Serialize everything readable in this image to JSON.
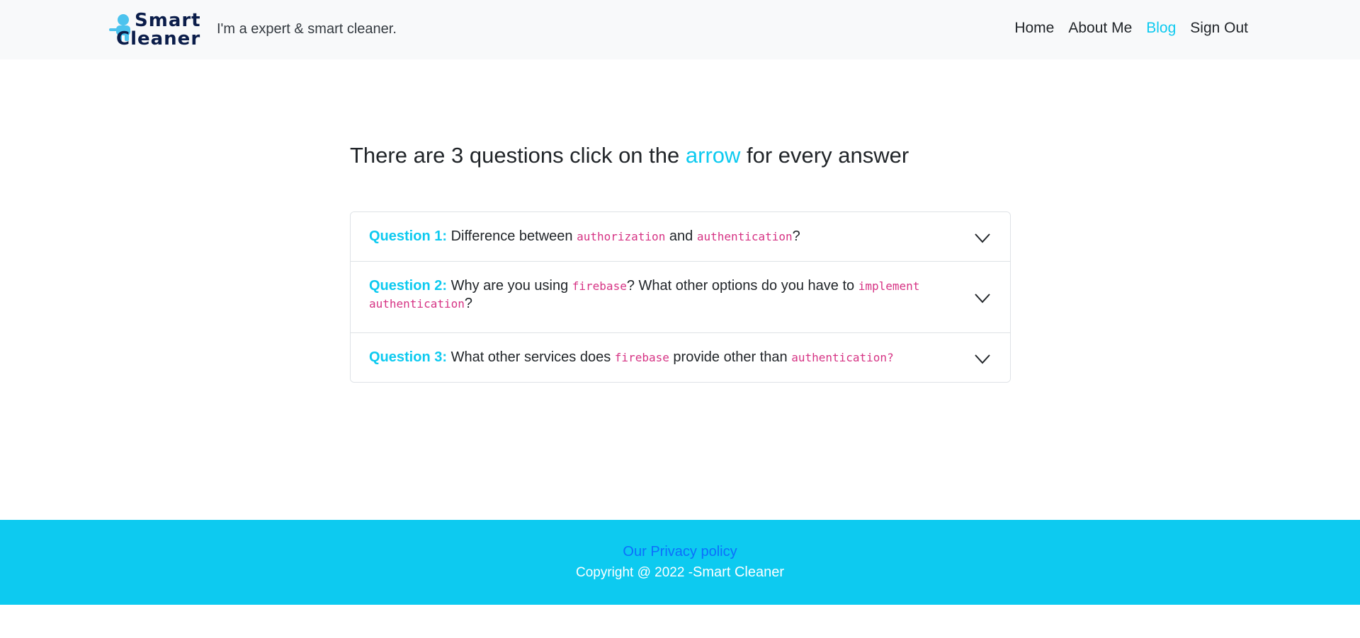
{
  "navbar": {
    "brand_line1": "Smart",
    "brand_line2": "Cleaner",
    "tagline": "I'm a expert & smart cleaner.",
    "links": [
      {
        "label": "Home",
        "active": false
      },
      {
        "label": "About Me",
        "active": false
      },
      {
        "label": "Blog",
        "active": true
      },
      {
        "label": "Sign Out",
        "active": false
      }
    ]
  },
  "main": {
    "heading_before": "There are 3 questions click on the ",
    "heading_accent": "arrow",
    "heading_after": " for every answer",
    "questions": [
      {
        "label": "Question 1:",
        "parts": [
          " Difference between ",
          "authorization",
          " and ",
          "authentication",
          "?"
        ]
      },
      {
        "label": "Question 2:",
        "parts": [
          " Why are you using ",
          "firebase",
          "? What other options do you have to ",
          "implement authentication",
          "?"
        ]
      },
      {
        "label": "Question 3:",
        "parts": [
          " What other services does ",
          "firebase",
          " provide other than ",
          "authentication?",
          ""
        ]
      }
    ]
  },
  "footer": {
    "privacy_link": "Our Privacy policy",
    "copyright_prefix": "Copyright @ 2022 -",
    "copyright_name": "Smart Cleaner"
  },
  "colors": {
    "accent": "#0dcaf0",
    "code": "#d63384",
    "footer_bg": "#0dcaf0",
    "link": "#0d6efd",
    "navbar_bg": "#f8f9fa"
  },
  "icons": [
    "brand-logo-icon",
    "chevron-down-icon"
  ]
}
